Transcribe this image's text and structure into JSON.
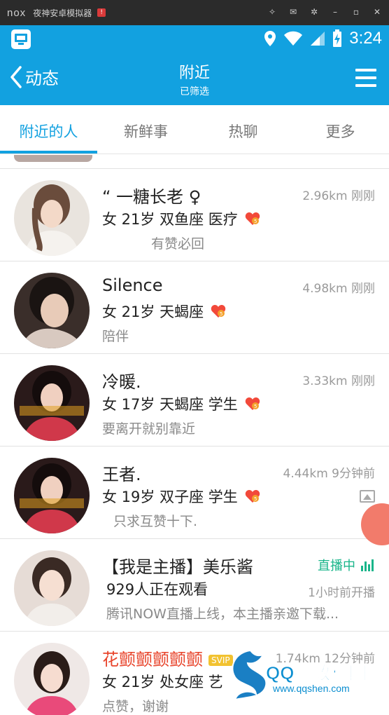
{
  "emulator": {
    "logo": "nox",
    "title": "夜神安卓模拟器",
    "badge": "!"
  },
  "status_bar": {
    "time": "3:24"
  },
  "header": {
    "back_label": "动态",
    "title": "附近",
    "subtitle": "已筛选"
  },
  "tabs": [
    {
      "label": "附近的人",
      "active": true
    },
    {
      "label": "新鲜事",
      "active": false
    },
    {
      "label": "热聊",
      "active": false
    },
    {
      "label": "更多",
      "active": false
    }
  ],
  "people": [
    {
      "name": "“ 一糖长老 ♀",
      "meta": "2.96km 刚刚",
      "info": "女 21岁 双鱼座 医疗",
      "signature": "有赞必回"
    },
    {
      "name": "Silence",
      "meta": "4.98km 刚刚",
      "info": "女 21岁 天蝎座",
      "signature": "陪伴"
    },
    {
      "name": "冷暖.",
      "meta": "3.33km 刚刚",
      "info": "女 17岁 天蝎座 学生",
      "signature": "要离开就别靠近"
    },
    {
      "name": "王者.",
      "meta": "4.44km 9分钟前",
      "info": "女 19岁 双子座 学生",
      "signature": "只求互赞十下."
    },
    {
      "name": "【我是主播】美乐酱",
      "meta": "直播中",
      "info": "929人正在观看",
      "sub": "1小时前开播",
      "signature": "腾讯NOW直播上线，本主播亲邀下载..."
    },
    {
      "name": "花颤颤颤颤颤",
      "meta": "1.74km 12分钟前",
      "info": "女 21岁 处女座 艺",
      "signature": "点赞，谢谢",
      "tag": "SVIP"
    }
  ],
  "watermark": {
    "text": "QQ神教程网",
    "url": "www.qqshen.com"
  },
  "colors": {
    "brand_blue": "#12a1e0",
    "live_green": "#19b58a",
    "heart_red": "#f2493a"
  }
}
